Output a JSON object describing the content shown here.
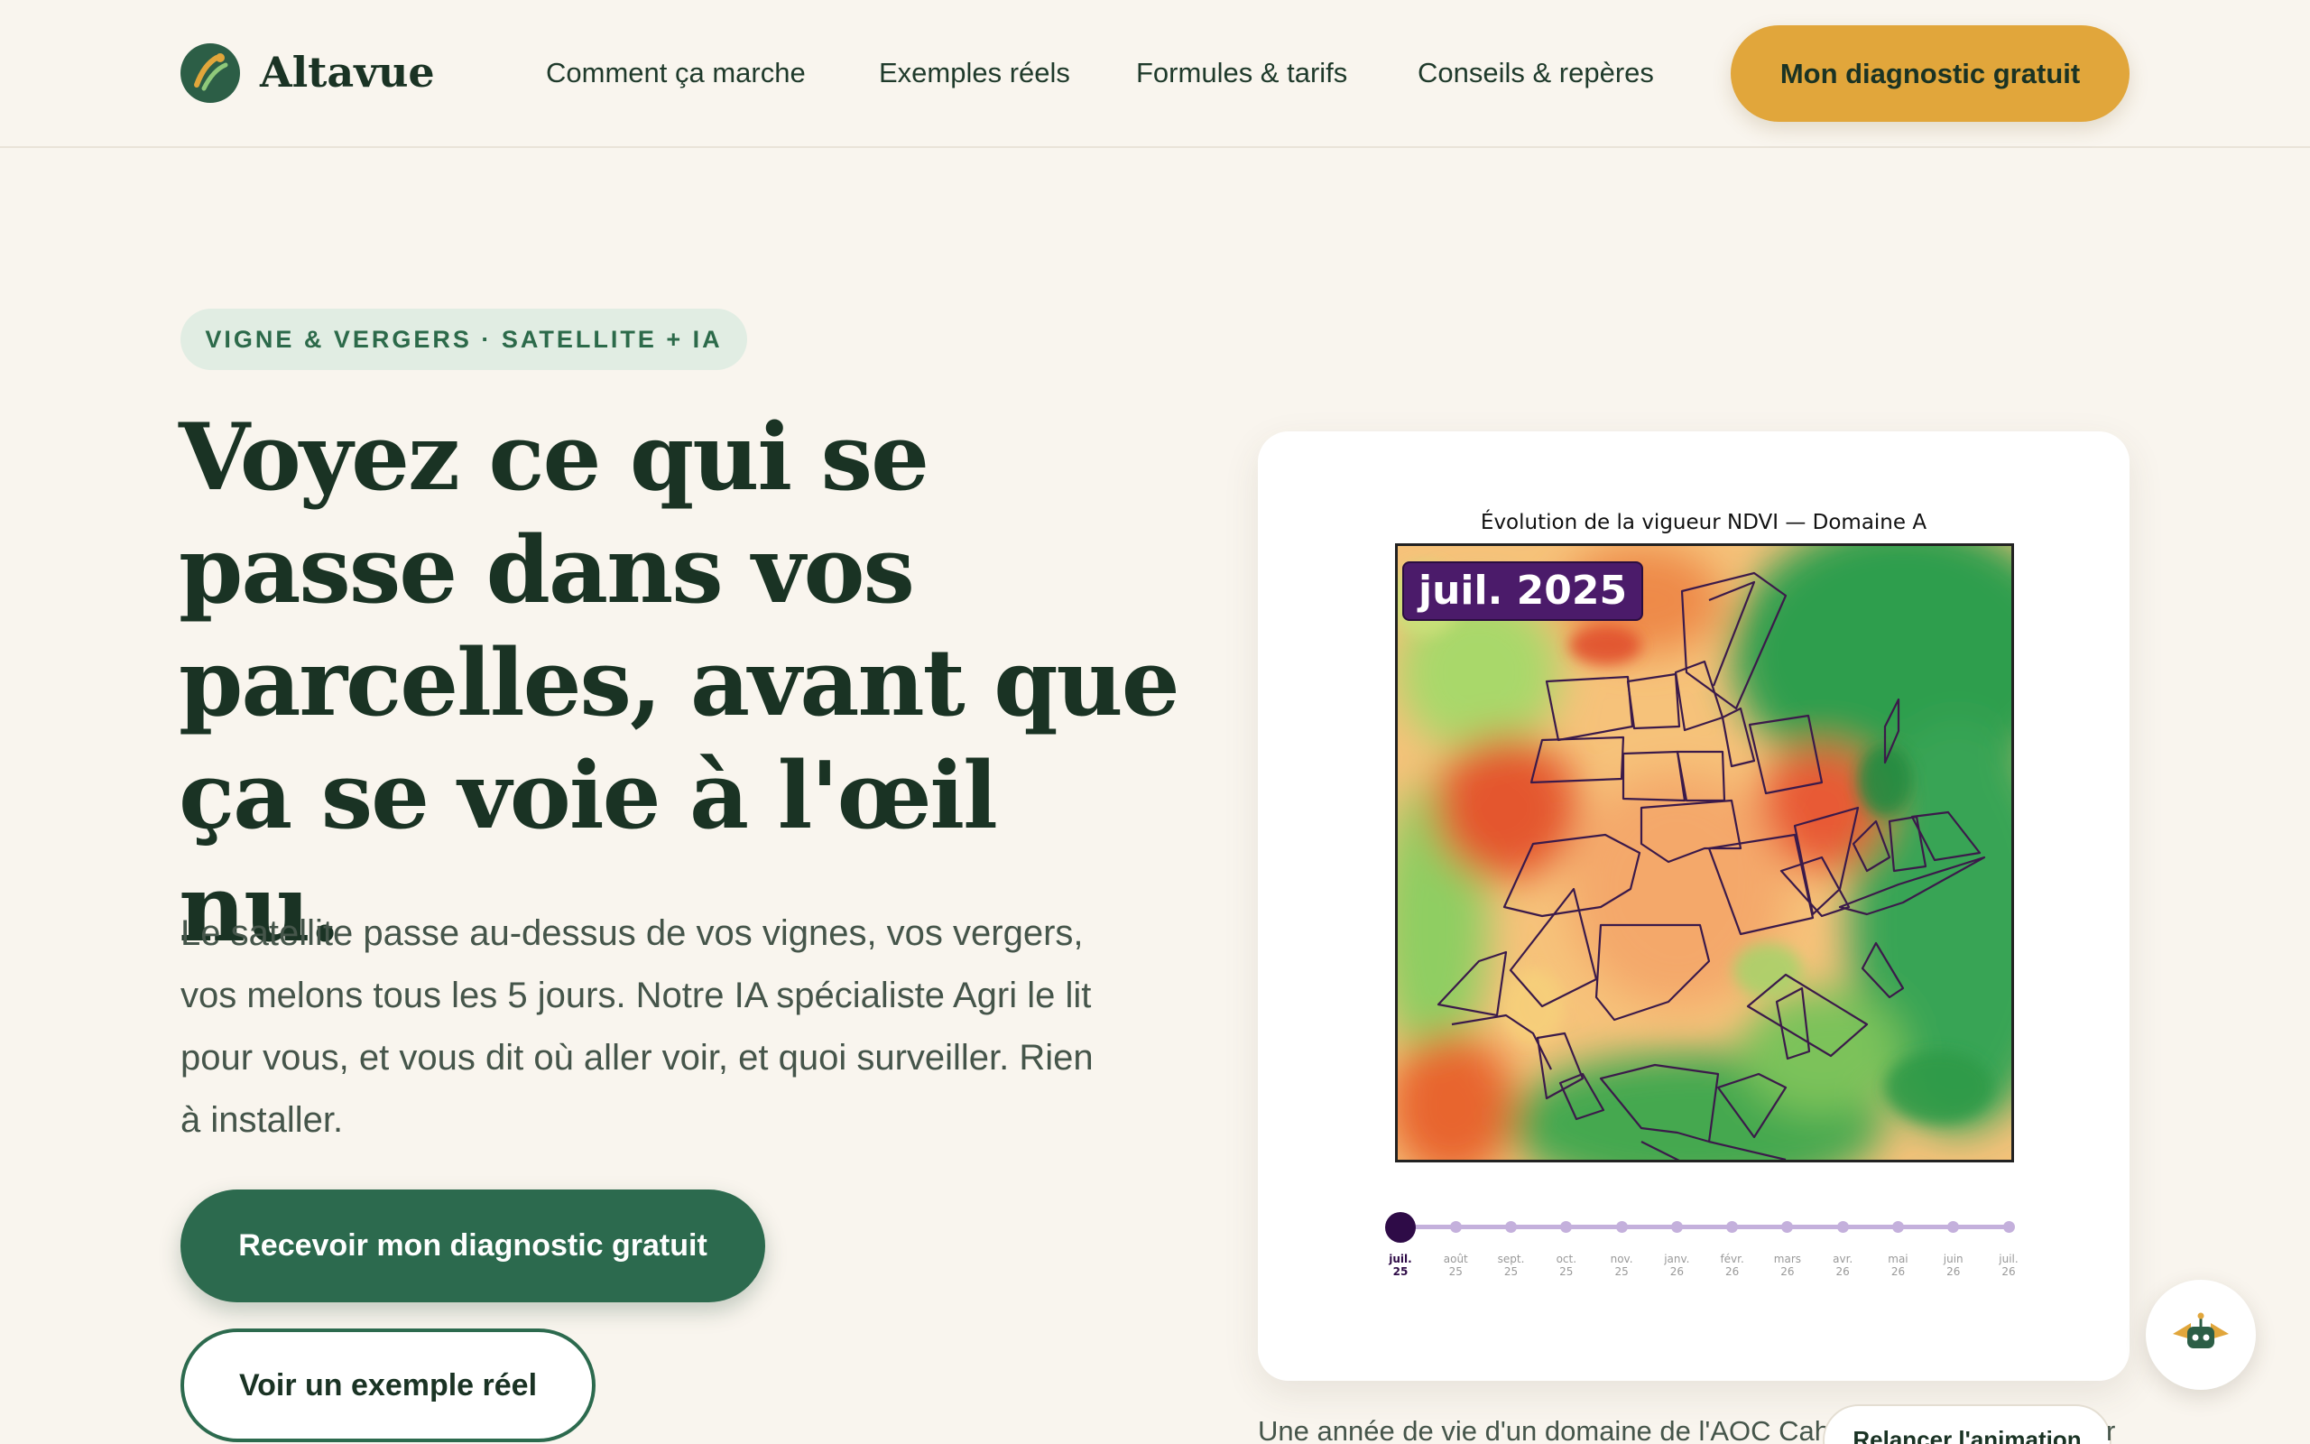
{
  "brand": {
    "name": "Altavue",
    "colors": {
      "primary": "#2c6a4e",
      "accent": "#e1a63b",
      "background": "#f9f5ee"
    }
  },
  "nav": {
    "items": [
      {
        "label": "Comment ça marche"
      },
      {
        "label": "Exemples réels"
      },
      {
        "label": "Formules & tarifs"
      },
      {
        "label": "Conseils & repères"
      }
    ],
    "cta": "Mon diagnostic gratuit"
  },
  "hero": {
    "tag": "VIGNE & VERGERS · SATELLITE + IA",
    "title": "Voyez ce qui se passe dans vos parcelles, avant que ça se voie à l'œil nu.",
    "subtitle": "Le satellite passe au-dessus de vos vignes, vos vergers, vos melons tous les 5 jours. Notre IA spécialiste Agri le lit pour vous, et vous dit où aller voir, et quoi surveiller. Rien à installer.",
    "primary_button": "Recevoir mon diagnostic gratuit",
    "secondary_button": "Voir un exemple réel"
  },
  "ndvi_card": {
    "title": "Évolution de la vigueur NDVI — Domaine A",
    "current_date": "juil. 2025",
    "timeline": [
      {
        "month": "juil.",
        "year": "25"
      },
      {
        "month": "août",
        "year": "25"
      },
      {
        "month": "sept.",
        "year": "25"
      },
      {
        "month": "oct.",
        "year": "25"
      },
      {
        "month": "nov.",
        "year": "25"
      },
      {
        "month": "janv.",
        "year": "26"
      },
      {
        "month": "févr.",
        "year": "26"
      },
      {
        "month": "mars",
        "year": "26"
      },
      {
        "month": "avr.",
        "year": "26"
      },
      {
        "month": "mai",
        "year": "26"
      },
      {
        "month": "juin",
        "year": "26"
      },
      {
        "month": "juil.",
        "year": "26"
      }
    ],
    "active_index": 0,
    "caption_start": "Une année de vie d'un domaine de l'AOC Caho",
    "caption_end": "r",
    "replay_button": "Relancer l'animation"
  },
  "assistant": {
    "icon": "robot-icon"
  }
}
